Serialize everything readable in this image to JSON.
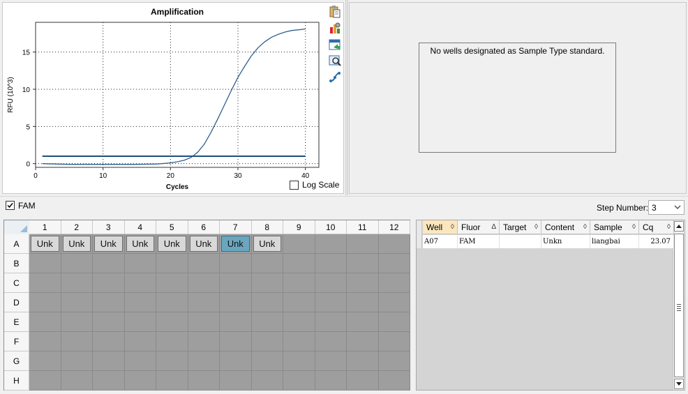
{
  "chart_data": {
    "type": "line",
    "title": "Amplification",
    "xlabel": "Cycles",
    "ylabel": "RFU (10^3)",
    "xlim": [
      0,
      42
    ],
    "ylim": [
      -0.5,
      19
    ],
    "xticks": [
      0,
      10,
      20,
      30,
      40
    ],
    "yticks": [
      0,
      5,
      10,
      15
    ],
    "grid": true,
    "series": [
      {
        "kind": "curve",
        "color": "#2f5f8f",
        "x": [
          1,
          5,
          10,
          15,
          18,
          20,
          21,
          22,
          23,
          24,
          25,
          26,
          27,
          28,
          29,
          30,
          31,
          32,
          33,
          34,
          35,
          36,
          37,
          38,
          39,
          40
        ],
        "y": [
          0.0,
          -0.1,
          -0.1,
          -0.1,
          -0.05,
          0.1,
          0.25,
          0.45,
          0.8,
          1.5,
          2.6,
          4.2,
          6.0,
          7.9,
          9.8,
          11.6,
          13.1,
          14.5,
          15.6,
          16.4,
          17.0,
          17.4,
          17.7,
          17.9,
          18.0,
          18.1
        ]
      },
      {
        "kind": "threshold",
        "color": "#1f4e79",
        "x": [
          1,
          40
        ],
        "y": [
          1.0,
          1.0
        ]
      }
    ]
  },
  "chart": {
    "log_scale_label": "Log Scale",
    "log_scale_checked": false,
    "toolbar_icons": [
      "clipboard-icon",
      "chart-settings-icon",
      "export-chart-icon",
      "zoom-chart-icon",
      "curve-fit-icon"
    ]
  },
  "standard_curve": {
    "message": "No wells designated as Sample Type standard."
  },
  "fluor_bar": {
    "fam_label": "FAM",
    "fam_checked": true,
    "step_label": "Step Number:",
    "step_value": "3"
  },
  "plate": {
    "columns": [
      "1",
      "2",
      "3",
      "4",
      "5",
      "6",
      "7",
      "8",
      "9",
      "10",
      "11",
      "12"
    ],
    "rows": [
      "A",
      "B",
      "C",
      "D",
      "E",
      "F",
      "G",
      "H"
    ],
    "wells": [
      {
        "row": "A",
        "col": "1",
        "label": "Unk",
        "selected": false
      },
      {
        "row": "A",
        "col": "2",
        "label": "Unk",
        "selected": false
      },
      {
        "row": "A",
        "col": "3",
        "label": "Unk",
        "selected": false
      },
      {
        "row": "A",
        "col": "4",
        "label": "Unk",
        "selected": false
      },
      {
        "row": "A",
        "col": "5",
        "label": "Unk",
        "selected": false
      },
      {
        "row": "A",
        "col": "6",
        "label": "Unk",
        "selected": false
      },
      {
        "row": "A",
        "col": "7",
        "label": "Unk",
        "selected": true
      },
      {
        "row": "A",
        "col": "8",
        "label": "Unk",
        "selected": false
      }
    ]
  },
  "results": {
    "columns": [
      {
        "label": "Well",
        "sort": "◊",
        "active": true
      },
      {
        "label": "Fluor",
        "sort": "Δ",
        "active": false
      },
      {
        "label": "Target",
        "sort": "◊",
        "active": false
      },
      {
        "label": "Content",
        "sort": "◊",
        "active": false
      },
      {
        "label": "Sample",
        "sort": "◊",
        "active": false
      },
      {
        "label": "Cq",
        "sort": "◊",
        "active": false
      }
    ],
    "rows": [
      {
        "well": "A07",
        "fluor": "FAM",
        "target": "",
        "content": "Unkn",
        "sample": "liangbai",
        "cq": "23.07"
      }
    ]
  }
}
